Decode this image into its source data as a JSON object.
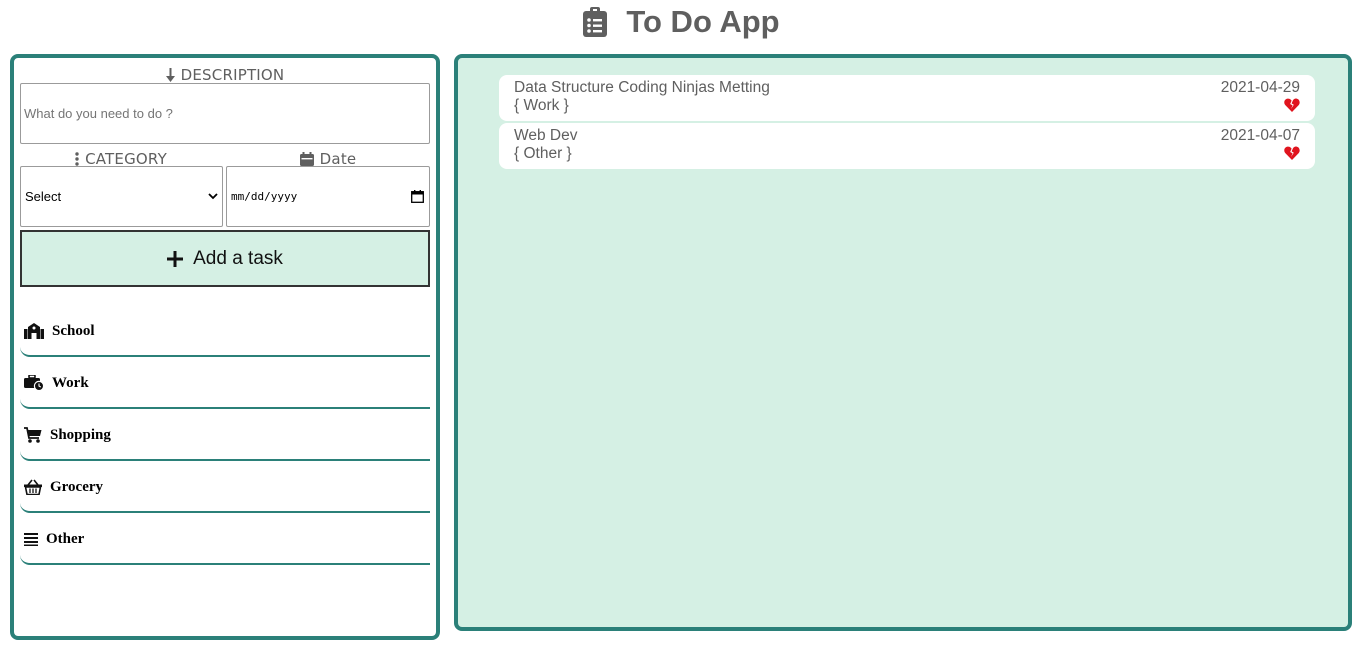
{
  "app": {
    "title": "To Do App"
  },
  "form": {
    "description_label": "DESCRIPTION",
    "description_placeholder": "What do you need to do ?",
    "category_label": "CATEGORY",
    "date_label": "Date",
    "category_selected": "Select",
    "date_placeholder": "mm/dd/yyyy",
    "add_button_label": "Add a task"
  },
  "categories": [
    {
      "label": "School",
      "icon": "school-icon"
    },
    {
      "label": "Work",
      "icon": "work-icon"
    },
    {
      "label": "Shopping",
      "icon": "cart-icon"
    },
    {
      "label": "Grocery",
      "icon": "basket-icon"
    },
    {
      "label": "Other",
      "icon": "list-icon"
    }
  ],
  "tasks": [
    {
      "description": "Data Structure Coding Ninjas Metting",
      "category": "{ Work }",
      "date": "2021-04-29",
      "delete_icon": "broken-heart-icon"
    },
    {
      "description": "Web Dev",
      "category": "{ Other }",
      "date": "2021-04-07",
      "delete_icon": "broken-heart-icon"
    }
  ],
  "colors": {
    "accent": "#2b8079",
    "panel_bg": "#d5f0e4",
    "delete": "#e0141e",
    "text": "#5f5f5f"
  }
}
